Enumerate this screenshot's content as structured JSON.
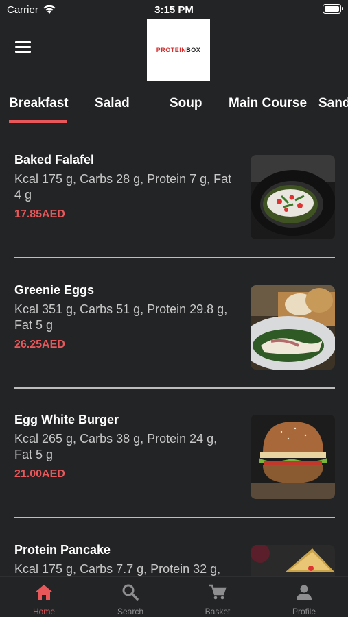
{
  "status": {
    "carrier": "Carrier",
    "time": "3:15 PM"
  },
  "header": {
    "logo_red": "PROTEIN",
    "logo_dark": "BOX"
  },
  "tabs": [
    {
      "label": "Breakfast",
      "active": true
    },
    {
      "label": "Salad"
    },
    {
      "label": "Soup"
    },
    {
      "label": "Main Course"
    },
    {
      "label": "Sand"
    }
  ],
  "items": [
    {
      "name": "Baked Falafel",
      "desc": "Kcal 175 g, Carbs 28 g, Protein 7 g, Fat 4 g",
      "price": "17.85AED"
    },
    {
      "name": "Greenie Eggs",
      "desc": "Kcal 351 g, Carbs 51 g, Protein 29.8 g, Fat 5 g",
      "price": "26.25AED"
    },
    {
      "name": "Egg White Burger",
      "desc": "Kcal 265 g, Carbs 38 g, Protein 24 g, Fat 5 g",
      "price": "21.00AED"
    },
    {
      "name": "Protein Pancake",
      "desc": "Kcal 175 g, Carbs 7.7 g, Protein 32 g,",
      "price": ""
    }
  ],
  "tabbar": [
    {
      "label": "Home",
      "icon": "home-icon",
      "active": true
    },
    {
      "label": "Search",
      "icon": "search-icon"
    },
    {
      "label": "Basket",
      "icon": "cart-icon"
    },
    {
      "label": "Profile",
      "icon": "profile-icon"
    }
  ],
  "colors": {
    "accent": "#e8585a",
    "background": "#232426",
    "inactive": "#8e8e90"
  }
}
